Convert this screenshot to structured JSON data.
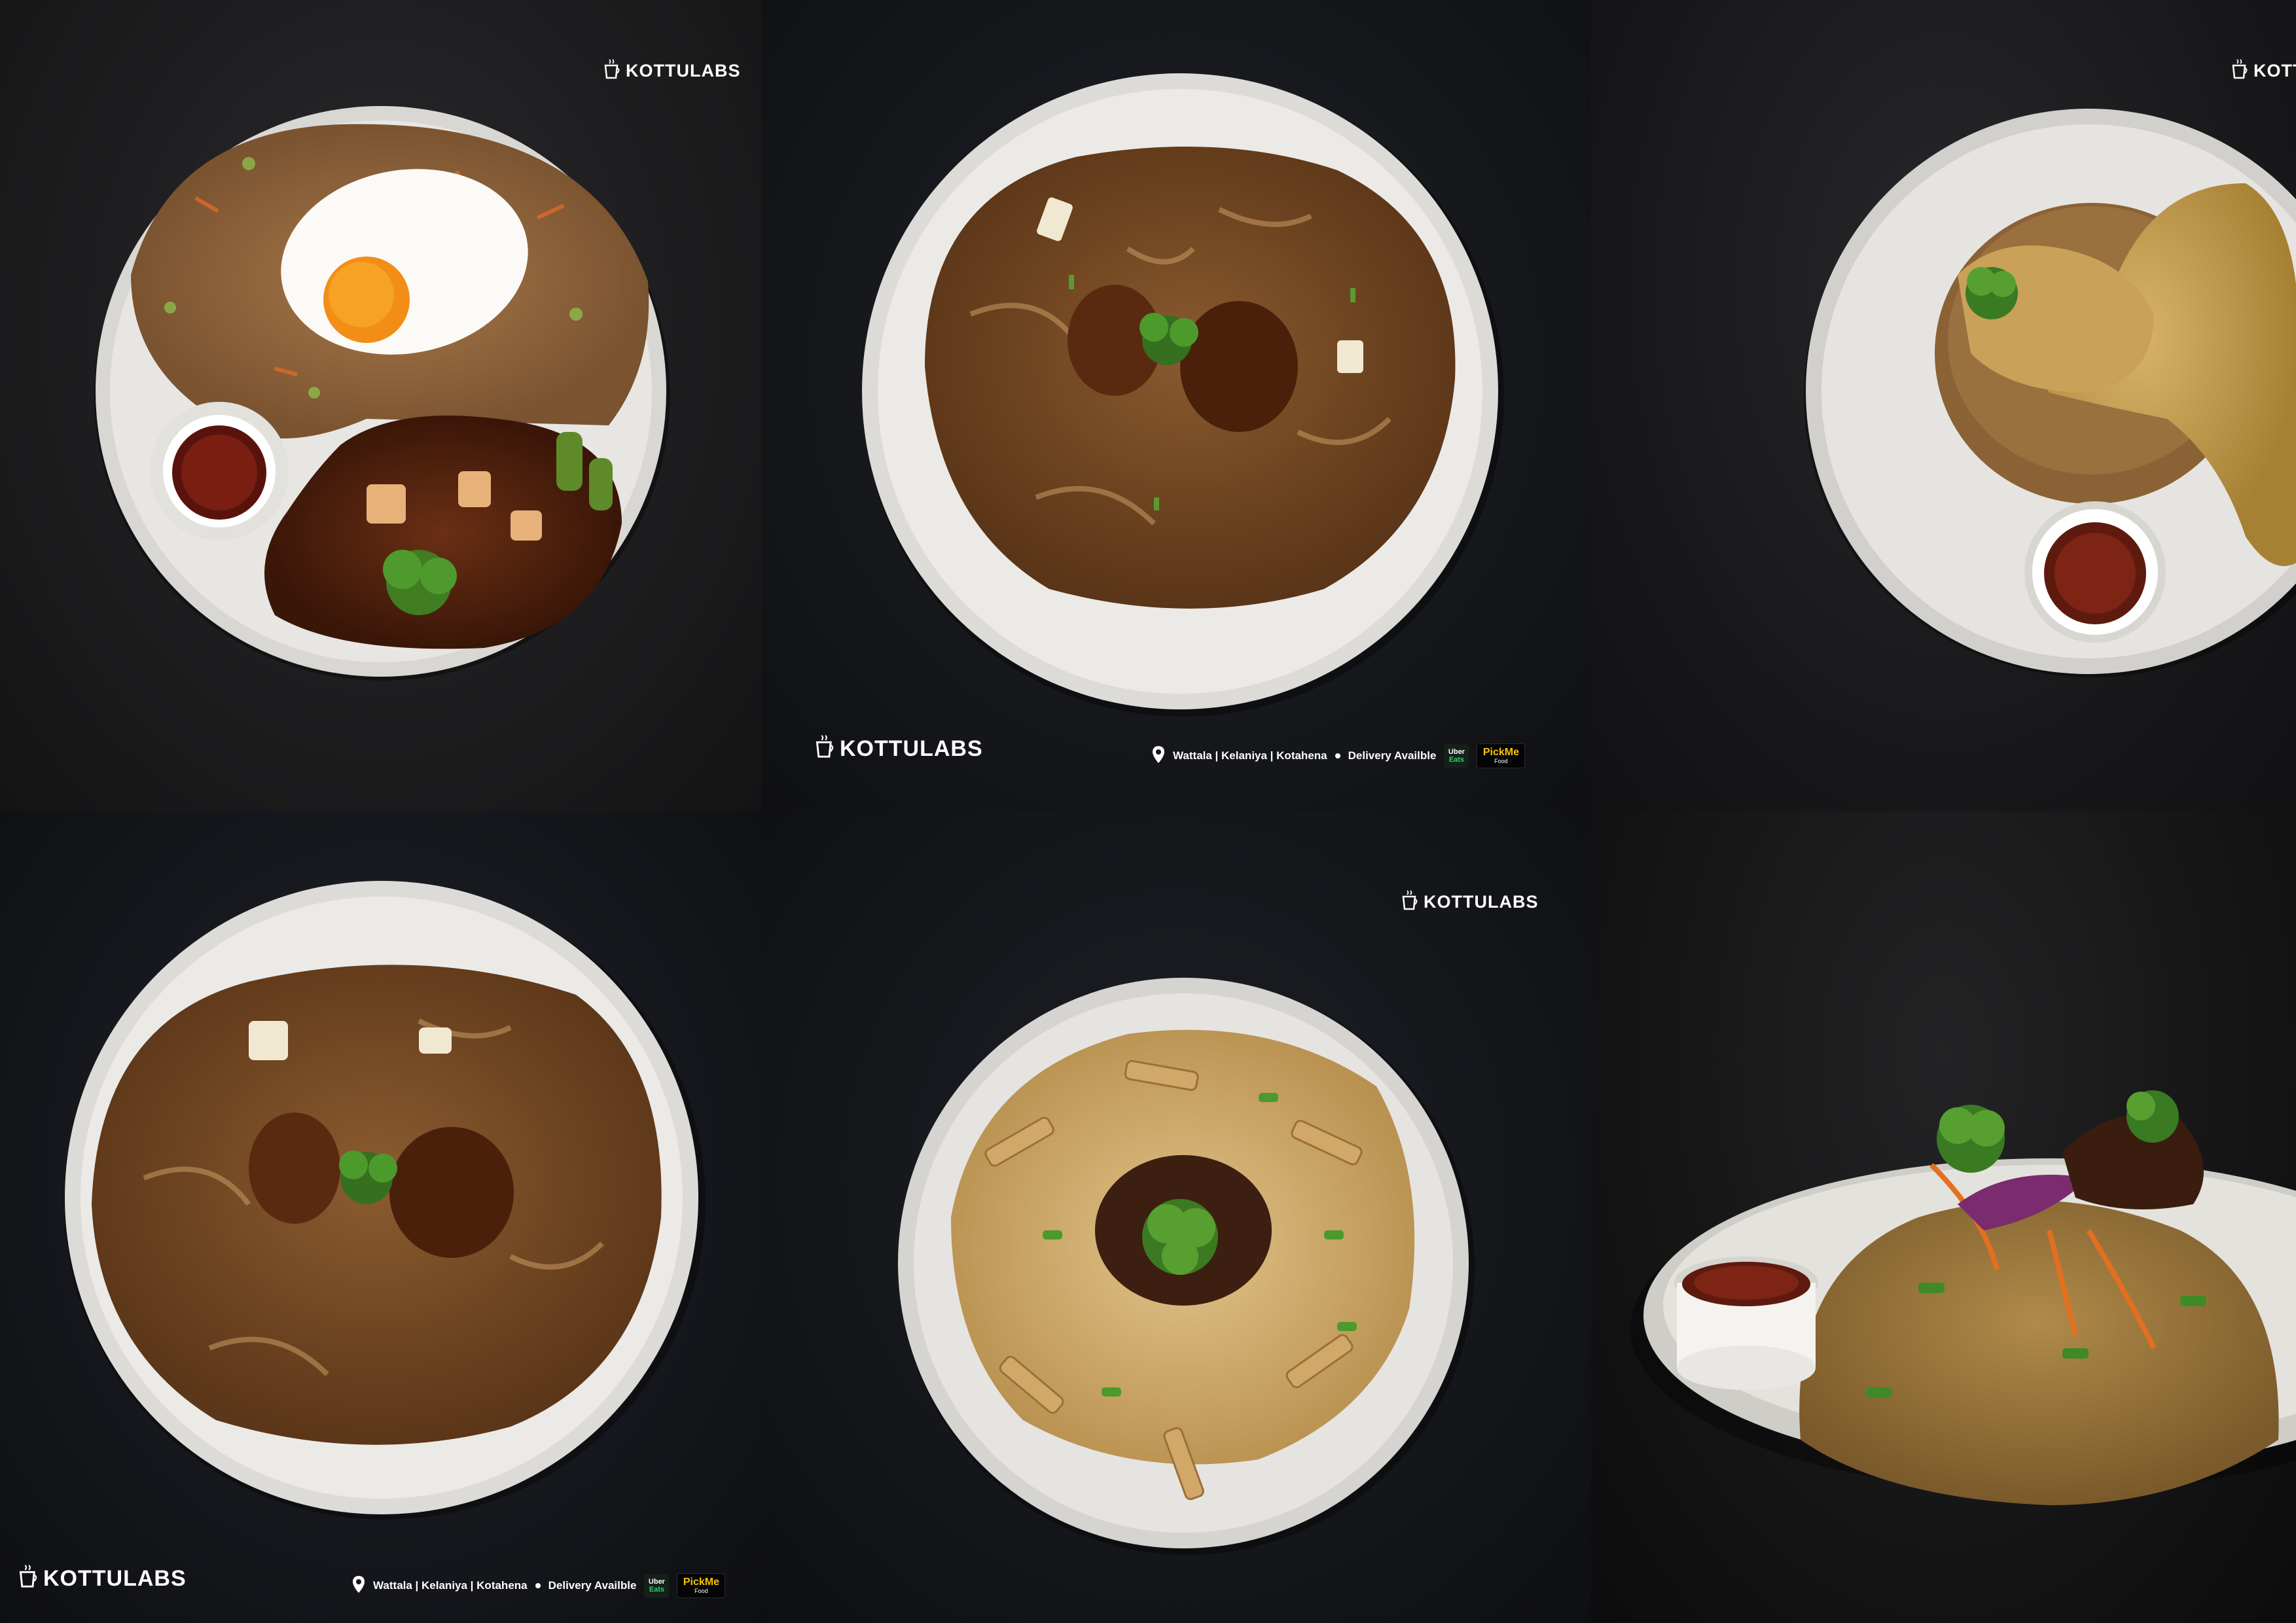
{
  "brand": {
    "name": "KOTTULABS"
  },
  "footer": {
    "locations": "Wattala | Kelaniya | Kotahena",
    "delivery": "Delivery Availble",
    "uber_top": "Uber",
    "uber_bottom": "Eats",
    "pickme_top": "PickMe",
    "pickme_bottom": "Food"
  },
  "colors": {
    "background": "#141415",
    "plate": "#e9e8e6",
    "uber_green": "#2fd16b",
    "pickme_yellow": "#f5c400"
  },
  "icons": [
    "coffee-cup-icon",
    "location-pin-icon"
  ]
}
